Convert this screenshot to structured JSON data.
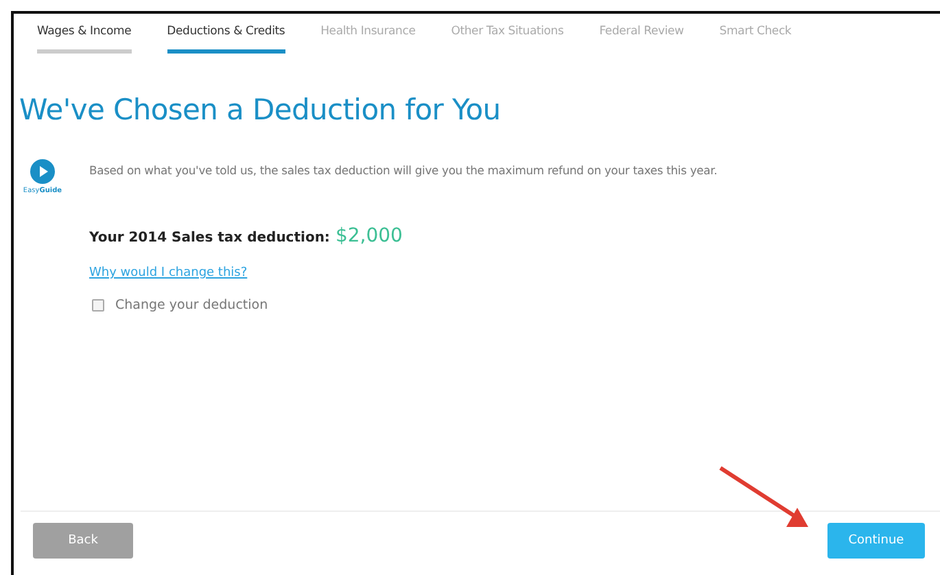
{
  "tabs": [
    {
      "label": "Wages & Income",
      "selected": false,
      "completed": true
    },
    {
      "label": "Deductions & Credits",
      "selected": true,
      "completed": false
    },
    {
      "label": "Health Insurance",
      "selected": false,
      "completed": false
    },
    {
      "label": "Other Tax Situations",
      "selected": false,
      "completed": false
    },
    {
      "label": "Federal Review",
      "selected": false,
      "completed": false
    },
    {
      "label": "Smart Check",
      "selected": false,
      "completed": false
    }
  ],
  "heading": "We've Chosen a Deduction for You",
  "guide": {
    "label": "Easy**Guide**",
    "text": "Based on what you've told us, the sales tax deduction will give you the maximum refund on your taxes this year."
  },
  "deduction": {
    "label": "Your 2014 Sales tax deduction:",
    "amount": "$2,000"
  },
  "link": "Why would I change this?",
  "checkbox": {
    "label": "Change your deduction",
    "checked": false
  },
  "buttons": {
    "back": "Back",
    "continue": "Continue"
  }
}
